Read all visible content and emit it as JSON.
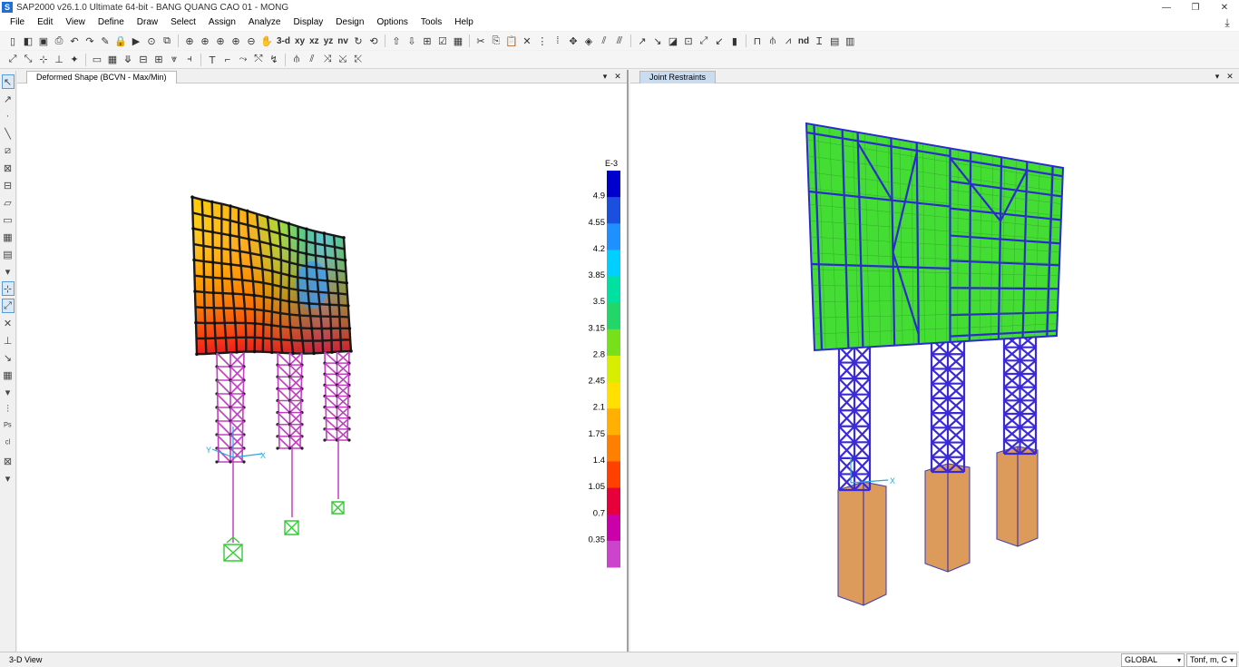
{
  "window": {
    "title": "SAP2000 v26.1.0 Ultimate 64-bit - BANG QUANG CAO 01 - MONG",
    "icon_letter": "S",
    "controls": [
      "—",
      "❐",
      "✕"
    ]
  },
  "menu": [
    "File",
    "Edit",
    "View",
    "Define",
    "Draw",
    "Select",
    "Assign",
    "Analyze",
    "Display",
    "Design",
    "Options",
    "Tools",
    "Help"
  ],
  "toolbar": {
    "view_3d": "3-d",
    "view_xy": "xy",
    "view_xz": "xz",
    "view_yz": "yz",
    "view_nv": "nv",
    "view_nd": "nd"
  },
  "left_pane": {
    "tab_title": "Deformed Shape (BCVN - Max/Min)",
    "legend": {
      "exponent": "E-3",
      "ticks": [
        "4.9",
        "4.55",
        "4.2",
        "3.85",
        "3.5",
        "3.15",
        "2.8",
        "2.45",
        "2.1",
        "1.75",
        "1.4",
        "1.05",
        "0.7",
        "0.35"
      ],
      "colors": [
        "#0000cc",
        "#1a4fe0",
        "#1e90ff",
        "#00d0ff",
        "#00e0a0",
        "#22d66a",
        "#77e01a",
        "#d8ee00",
        "#ffe000",
        "#ffb000",
        "#ff8000",
        "#ff4000",
        "#e8003a",
        "#cc00aa",
        "#cc44cc"
      ]
    },
    "axis": {
      "x": "X",
      "y": "Y"
    }
  },
  "right_pane": {
    "tab_title": "Joint Restraints",
    "axis": {
      "x": "X"
    }
  },
  "status": {
    "view_label": "3-D View",
    "coord_system": "GLOBAL",
    "units": "Tonf, m, C"
  },
  "colors": {
    "frame_blue": "#2222cc",
    "shell_green": "#33dd33",
    "foundation_orange": "#d9904a",
    "column_magenta": "#c040c0",
    "support_green": "#33cc33"
  }
}
